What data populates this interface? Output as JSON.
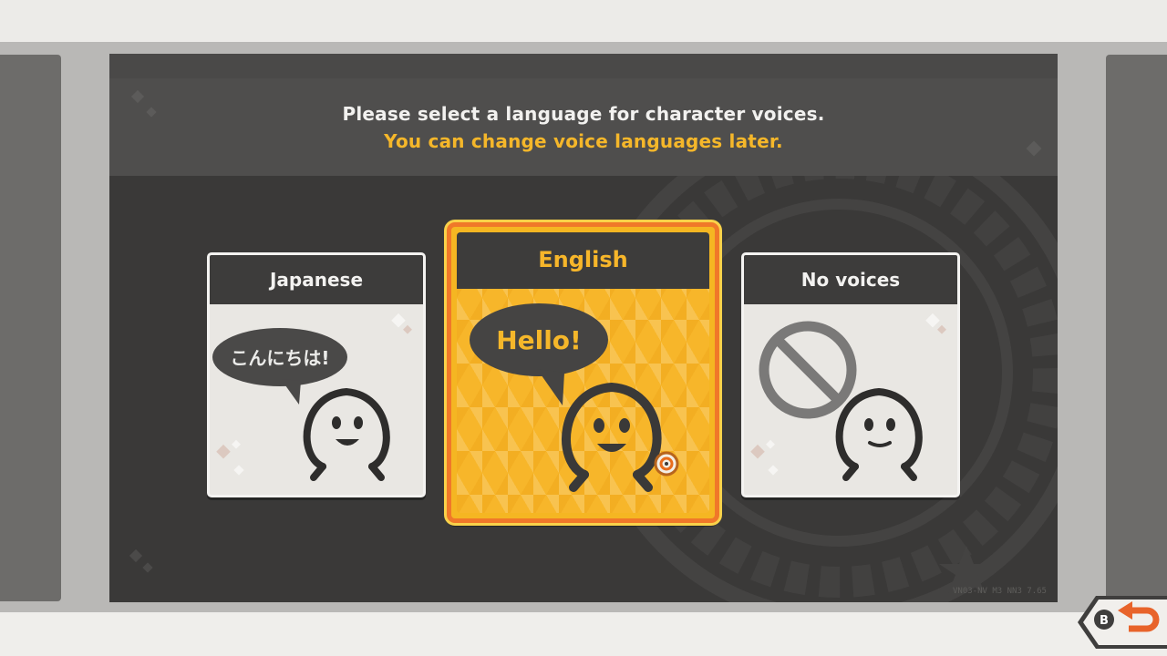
{
  "header": {
    "prompt": "Please select a language for character voices.",
    "subprompt": "You can change voice languages later."
  },
  "options": [
    {
      "label": "Japanese",
      "bubble": "こんにちは!",
      "icon": "character-talking-icon"
    },
    {
      "label": "English",
      "bubble": "Hello!",
      "icon": "character-talking-icon",
      "selected": true
    },
    {
      "label": "No voices",
      "icon": "no-voice-prohibited-icon"
    }
  ],
  "footer": {
    "back_button": {
      "key": "B",
      "icon": "return-arrow-icon"
    }
  },
  "colors": {
    "accent_yellow": "#f5b72a",
    "selected_border": "#f07829",
    "panel_dark": "#3a3938"
  }
}
